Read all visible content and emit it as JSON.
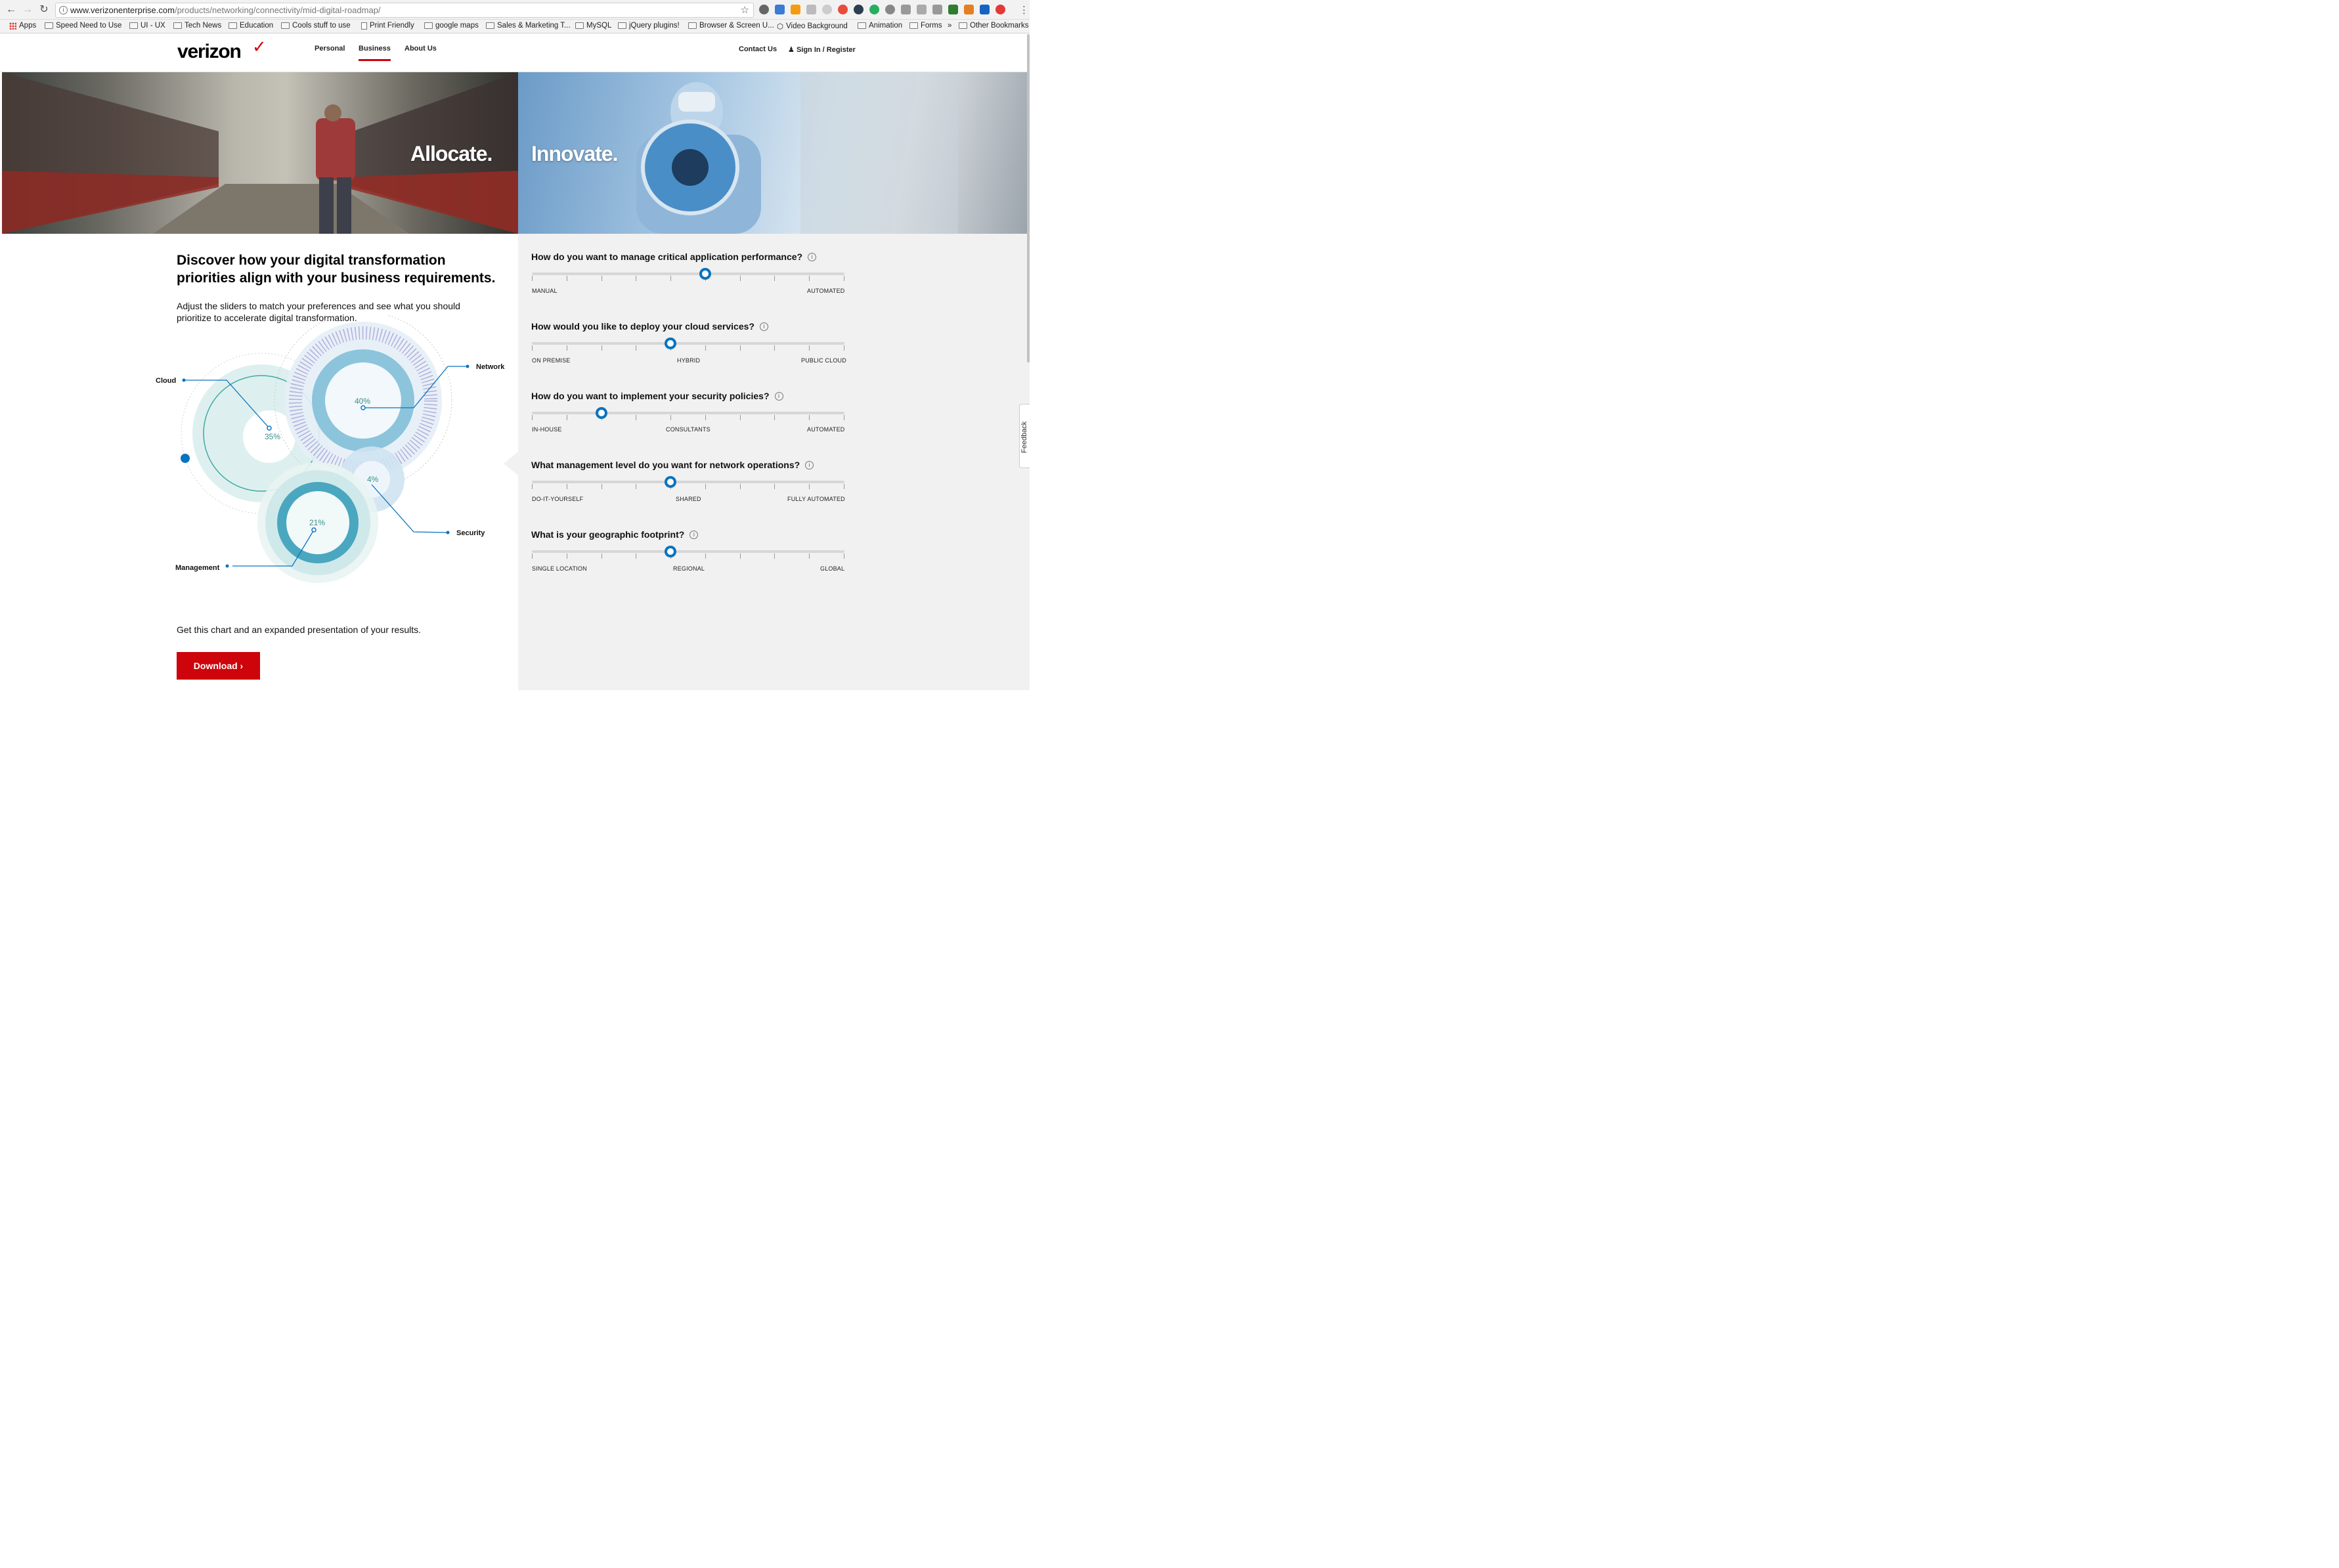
{
  "browser": {
    "url_domain": "www.verizonenterprise.com",
    "url_path": "/products/networking/connectivity/mid-digital-roadmap/",
    "bookmarks": [
      "Apps",
      "Speed Need to Use",
      "UI - UX",
      "Tech News",
      "Education",
      "Cools stuff to use",
      "Print Friendly",
      "google maps",
      "Sales & Marketing T...",
      "MySQL",
      "jQuery plugins!",
      "Browser & Screen U...",
      "Video Background",
      "Animation",
      "Forms",
      "»",
      "Other Bookmarks"
    ]
  },
  "header": {
    "logo": "verizon",
    "logo_check": "✓",
    "nav": [
      "Personal",
      "Business",
      "About Us"
    ],
    "contact": "Contact Us",
    "signin": "Sign In / Register"
  },
  "hero": {
    "left_word": "Allocate.",
    "right_word": "Innovate."
  },
  "main": {
    "headline": "Discover how your digital transformation priorities align with your business requirements.",
    "subtext": "Adjust the sliders to match your preferences and see what you should prioritize to accelerate digital transformation.",
    "cta_text": "Get this chart and an expanded presentation of your results.",
    "download_label": "Download ›"
  },
  "chart_labels": {
    "cloud": "Cloud",
    "network": "Network",
    "security": "Security",
    "management": "Management",
    "cloud_pct": "35%",
    "network_pct": "40%",
    "security_pct": "4%",
    "management_pct": "21%"
  },
  "questions": [
    {
      "text": "How do you want to manage critical application performance?",
      "value": 0.555,
      "labels": [
        "MANUAL",
        "",
        "AUTOMATED"
      ]
    },
    {
      "text": "How would you like to deploy your cloud services?",
      "value": 0.444,
      "labels": [
        "ON PREMISE",
        "HYBRID",
        "PUBLIC CLOUD"
      ]
    },
    {
      "text": "How do you want to implement your security policies?",
      "value": 0.222,
      "labels": [
        "IN-HOUSE",
        "CONSULTANTS",
        "AUTOMATED"
      ]
    },
    {
      "text": "What management level do you want for network operations?",
      "value": 0.444,
      "labels": [
        "DO-IT-YOURSELF",
        "SHARED",
        "FULLY AUTOMATED"
      ]
    },
    {
      "text": "What is your geographic footprint?",
      "value": 0.444,
      "labels": [
        "SINGLE LOCATION",
        "REGIONAL",
        "GLOBAL"
      ]
    }
  ],
  "feedback": "Feedback",
  "colors": {
    "brand_red": "#cd040b",
    "slider_blue": "#0a73c0"
  }
}
